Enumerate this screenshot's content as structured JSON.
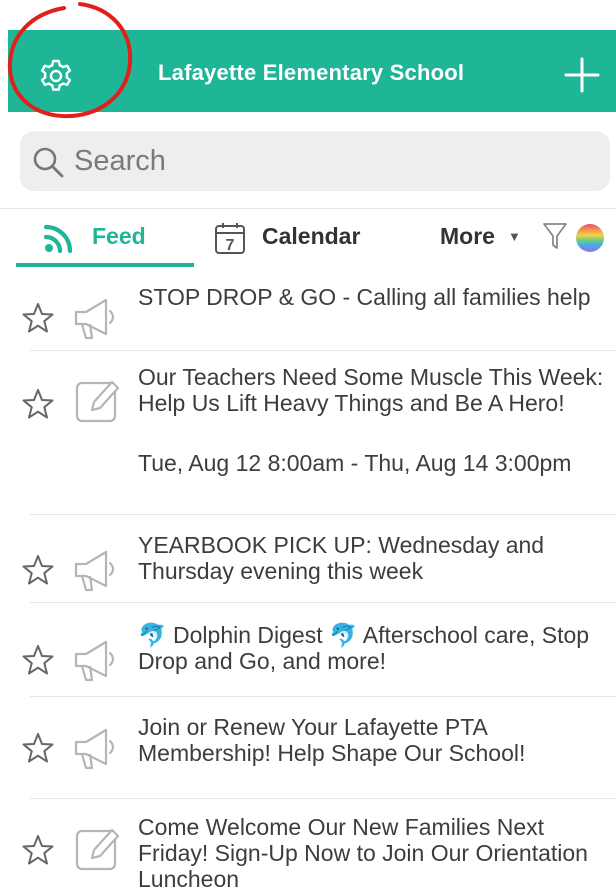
{
  "header": {
    "title": "Lafayette Elementary School",
    "settings_icon": "gear-icon",
    "add_icon": "plus-icon",
    "color": "#1fb597"
  },
  "annotation": {
    "color": "#e0201c",
    "shape": "hand-drawn circle around settings icon"
  },
  "search": {
    "placeholder": "Search",
    "icon": "search-icon"
  },
  "tabs": {
    "feed": {
      "label": "Feed",
      "icon": "rss-feed-icon",
      "active": true
    },
    "calendar": {
      "label": "Calendar",
      "icon": "calendar-icon",
      "day": "7"
    },
    "more": {
      "label": "More",
      "icon": "caret-down-icon"
    },
    "filter_icon": "filter-icon",
    "color_icon": "rainbow-circle-icon"
  },
  "feed": [
    {
      "type": "announcement",
      "icon": "megaphone-icon",
      "title": "STOP DROP & GO - Calling all families help",
      "date": ""
    },
    {
      "type": "signup",
      "icon": "pencil-square-icon",
      "title": "Our Teachers Need Some Muscle This Week: Help Us Lift Heavy Things and Be A Hero!",
      "date": "Tue, Aug 12 8:00am - Thu, Aug 14 3:00pm"
    },
    {
      "type": "announcement",
      "icon": "megaphone-icon",
      "title": "YEARBOOK PICK UP: Wednesday and Thursday evening this week",
      "date": ""
    },
    {
      "type": "announcement",
      "icon": "megaphone-icon",
      "title": "🐬 Dolphin Digest 🐬 Afterschool care, Stop Drop and Go, and more!",
      "date": ""
    },
    {
      "type": "announcement",
      "icon": "megaphone-icon",
      "title": "Join or Renew Your Lafayette PTA Membership! Help Shape Our School!",
      "date": ""
    },
    {
      "type": "signup",
      "icon": "pencil-square-icon",
      "title": "Come Welcome Our New Families Next Friday! Sign-Up Now to Join Our Orientation Luncheon",
      "date": ""
    }
  ]
}
